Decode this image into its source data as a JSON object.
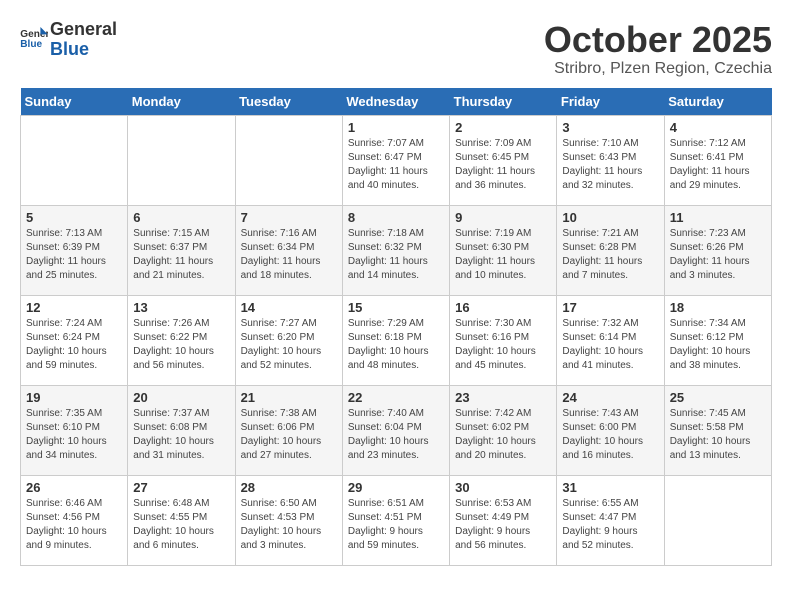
{
  "header": {
    "logo_line1": "General",
    "logo_line2": "Blue",
    "title": "October 2025",
    "subtitle": "Stribro, Plzen Region, Czechia"
  },
  "weekdays": [
    "Sunday",
    "Monday",
    "Tuesday",
    "Wednesday",
    "Thursday",
    "Friday",
    "Saturday"
  ],
  "weeks": [
    [
      {
        "day": "",
        "info": ""
      },
      {
        "day": "",
        "info": ""
      },
      {
        "day": "",
        "info": ""
      },
      {
        "day": "1",
        "info": "Sunrise: 7:07 AM\nSunset: 6:47 PM\nDaylight: 11 hours\nand 40 minutes."
      },
      {
        "day": "2",
        "info": "Sunrise: 7:09 AM\nSunset: 6:45 PM\nDaylight: 11 hours\nand 36 minutes."
      },
      {
        "day": "3",
        "info": "Sunrise: 7:10 AM\nSunset: 6:43 PM\nDaylight: 11 hours\nand 32 minutes."
      },
      {
        "day": "4",
        "info": "Sunrise: 7:12 AM\nSunset: 6:41 PM\nDaylight: 11 hours\nand 29 minutes."
      }
    ],
    [
      {
        "day": "5",
        "info": "Sunrise: 7:13 AM\nSunset: 6:39 PM\nDaylight: 11 hours\nand 25 minutes."
      },
      {
        "day": "6",
        "info": "Sunrise: 7:15 AM\nSunset: 6:37 PM\nDaylight: 11 hours\nand 21 minutes."
      },
      {
        "day": "7",
        "info": "Sunrise: 7:16 AM\nSunset: 6:34 PM\nDaylight: 11 hours\nand 18 minutes."
      },
      {
        "day": "8",
        "info": "Sunrise: 7:18 AM\nSunset: 6:32 PM\nDaylight: 11 hours\nand 14 minutes."
      },
      {
        "day": "9",
        "info": "Sunrise: 7:19 AM\nSunset: 6:30 PM\nDaylight: 11 hours\nand 10 minutes."
      },
      {
        "day": "10",
        "info": "Sunrise: 7:21 AM\nSunset: 6:28 PM\nDaylight: 11 hours\nand 7 minutes."
      },
      {
        "day": "11",
        "info": "Sunrise: 7:23 AM\nSunset: 6:26 PM\nDaylight: 11 hours\nand 3 minutes."
      }
    ],
    [
      {
        "day": "12",
        "info": "Sunrise: 7:24 AM\nSunset: 6:24 PM\nDaylight: 10 hours\nand 59 minutes."
      },
      {
        "day": "13",
        "info": "Sunrise: 7:26 AM\nSunset: 6:22 PM\nDaylight: 10 hours\nand 56 minutes."
      },
      {
        "day": "14",
        "info": "Sunrise: 7:27 AM\nSunset: 6:20 PM\nDaylight: 10 hours\nand 52 minutes."
      },
      {
        "day": "15",
        "info": "Sunrise: 7:29 AM\nSunset: 6:18 PM\nDaylight: 10 hours\nand 48 minutes."
      },
      {
        "day": "16",
        "info": "Sunrise: 7:30 AM\nSunset: 6:16 PM\nDaylight: 10 hours\nand 45 minutes."
      },
      {
        "day": "17",
        "info": "Sunrise: 7:32 AM\nSunset: 6:14 PM\nDaylight: 10 hours\nand 41 minutes."
      },
      {
        "day": "18",
        "info": "Sunrise: 7:34 AM\nSunset: 6:12 PM\nDaylight: 10 hours\nand 38 minutes."
      }
    ],
    [
      {
        "day": "19",
        "info": "Sunrise: 7:35 AM\nSunset: 6:10 PM\nDaylight: 10 hours\nand 34 minutes."
      },
      {
        "day": "20",
        "info": "Sunrise: 7:37 AM\nSunset: 6:08 PM\nDaylight: 10 hours\nand 31 minutes."
      },
      {
        "day": "21",
        "info": "Sunrise: 7:38 AM\nSunset: 6:06 PM\nDaylight: 10 hours\nand 27 minutes."
      },
      {
        "day": "22",
        "info": "Sunrise: 7:40 AM\nSunset: 6:04 PM\nDaylight: 10 hours\nand 23 minutes."
      },
      {
        "day": "23",
        "info": "Sunrise: 7:42 AM\nSunset: 6:02 PM\nDaylight: 10 hours\nand 20 minutes."
      },
      {
        "day": "24",
        "info": "Sunrise: 7:43 AM\nSunset: 6:00 PM\nDaylight: 10 hours\nand 16 minutes."
      },
      {
        "day": "25",
        "info": "Sunrise: 7:45 AM\nSunset: 5:58 PM\nDaylight: 10 hours\nand 13 minutes."
      }
    ],
    [
      {
        "day": "26",
        "info": "Sunrise: 6:46 AM\nSunset: 4:56 PM\nDaylight: 10 hours\nand 9 minutes."
      },
      {
        "day": "27",
        "info": "Sunrise: 6:48 AM\nSunset: 4:55 PM\nDaylight: 10 hours\nand 6 minutes."
      },
      {
        "day": "28",
        "info": "Sunrise: 6:50 AM\nSunset: 4:53 PM\nDaylight: 10 hours\nand 3 minutes."
      },
      {
        "day": "29",
        "info": "Sunrise: 6:51 AM\nSunset: 4:51 PM\nDaylight: 9 hours\nand 59 minutes."
      },
      {
        "day": "30",
        "info": "Sunrise: 6:53 AM\nSunset: 4:49 PM\nDaylight: 9 hours\nand 56 minutes."
      },
      {
        "day": "31",
        "info": "Sunrise: 6:55 AM\nSunset: 4:47 PM\nDaylight: 9 hours\nand 52 minutes."
      },
      {
        "day": "",
        "info": ""
      }
    ]
  ]
}
